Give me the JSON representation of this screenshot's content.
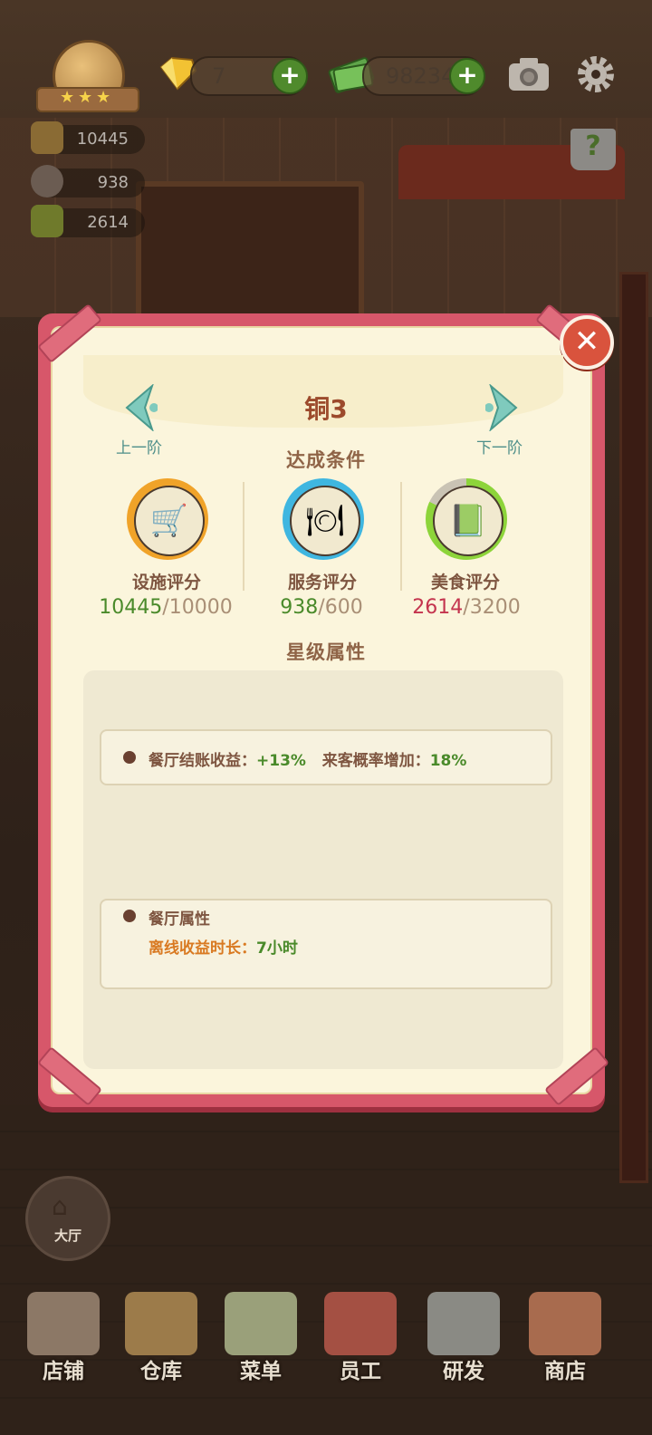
{
  "top_bar": {
    "diamonds": "7",
    "cash": "98234",
    "plus_label": "+",
    "rank_stars": 3,
    "icons": [
      "diamond-icon",
      "cash-icon",
      "camera-icon",
      "gear-icon",
      "help-book-icon"
    ]
  },
  "side_stats": {
    "facility": "10445",
    "service": "938",
    "food": "2614"
  },
  "help_label": "?",
  "modal": {
    "close_label": "✕",
    "title": "铜3",
    "prev_label": "上一阶",
    "next_label": "下一阶",
    "conditions_label": "达成条件",
    "metrics": [
      {
        "label": "设施评分",
        "current": "10445",
        "sep": "/",
        "target": "10000",
        "current_color": "#4a8a2a",
        "ring_color": "#f0a329",
        "progress": 1.0,
        "icon": "gold-cart-icon"
      },
      {
        "label": "服务评分",
        "current": "938",
        "sep": "/",
        "target": "600",
        "current_color": "#4a8a2a",
        "ring_color": "#3fb6e0",
        "progress": 1.0,
        "icon": "cloche-icon"
      },
      {
        "label": "美食评分",
        "current": "2614",
        "sep": "/",
        "target": "3200",
        "current_color": "#c4344e",
        "ring_color": "#8dd43a",
        "progress": 0.82,
        "icon": "recipe-book-icon"
      }
    ],
    "star_attr_label": "星级属性",
    "attr1": {
      "label1": "餐厅结账收益：",
      "value1": "+13%",
      "label2": "来客概率增加：",
      "value2": "18%"
    },
    "attr2": {
      "title": "餐厅属性",
      "label": "离线收益时长：",
      "value": "7小时"
    }
  },
  "hall_button": {
    "label": "大厅"
  },
  "bottom_nav": [
    {
      "label": "店铺",
      "icon": "shop-icon",
      "color": "#8c7866"
    },
    {
      "label": "仓库",
      "icon": "warehouse-icon",
      "color": "#9c7b4a"
    },
    {
      "label": "菜单",
      "icon": "menu-clipboard-icon",
      "color": "#9aa07a"
    },
    {
      "label": "员工",
      "icon": "staff-icon",
      "color": "#a45043"
    },
    {
      "label": "研发",
      "icon": "wok-icon",
      "color": "#8a8a84"
    },
    {
      "label": "商店",
      "icon": "store-icon",
      "color": "#a86b4e"
    }
  ],
  "colors": {
    "modal_border": "#d7576a",
    "panel_bg": "#fbf5dc",
    "title": "#9c4a2c",
    "accent_green": "#4a8a2a",
    "accent_red": "#c4344e"
  }
}
